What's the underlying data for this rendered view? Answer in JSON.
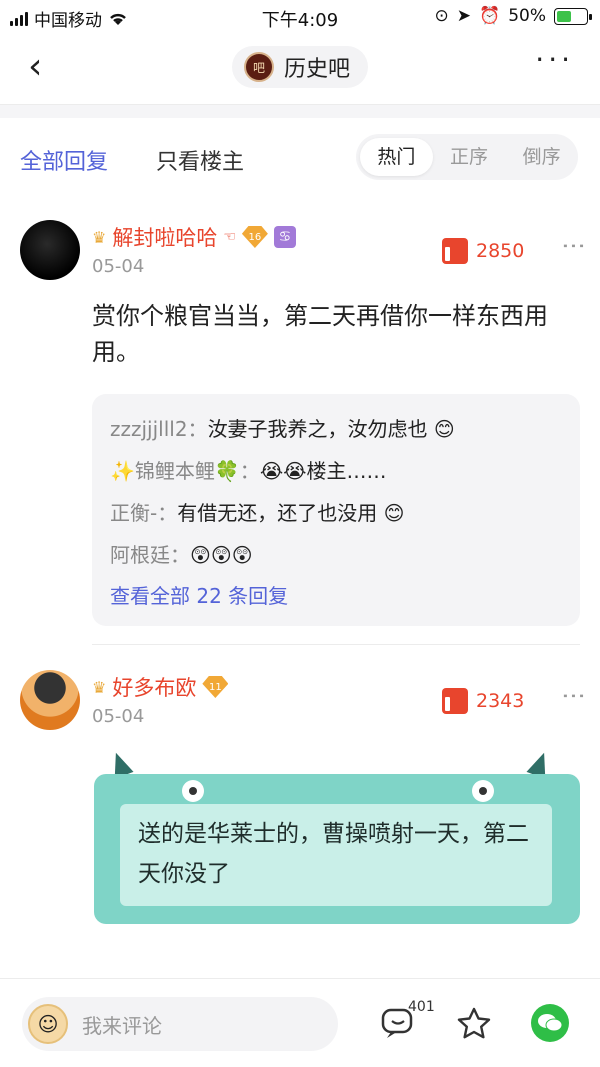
{
  "status_bar": {
    "carrier": "中国移动",
    "time": "下午4:09",
    "battery": "50%",
    "battery_level": 0.5
  },
  "nav": {
    "forum_name": "历史吧",
    "logo_text": "吧"
  },
  "tabs": {
    "all_replies": "全部回复",
    "op_only": "只看楼主",
    "sort": [
      "热门",
      "正序",
      "倒序"
    ]
  },
  "comments": [
    {
      "username": "解封啦哈哈",
      "level": "16",
      "date": "05-04",
      "likes": "2850",
      "text": "赏你个粮官当当，第二天再借你一样东西用用。",
      "replies": [
        {
          "who": "zzzjjjlll2：",
          "text": "汝妻子我养之，汝勿虑也 😊"
        },
        {
          "who": "✨锦鲤本鲤🍀：",
          "text": "😭😭楼主……"
        },
        {
          "who": "正衡-：",
          "text": "有借无还，还了也没用 😊"
        },
        {
          "who": "阿根廷：",
          "text": "😲😲😲"
        }
      ],
      "view_all": "查看全部 22 条回复"
    },
    {
      "username": "好多布欧",
      "level": "11",
      "date": "05-04",
      "likes": "2343",
      "text": "送的是华莱士的，曹操喷射一天，第二天你没了"
    }
  ],
  "bottom": {
    "placeholder": "我来评论",
    "reply_count": "401"
  }
}
